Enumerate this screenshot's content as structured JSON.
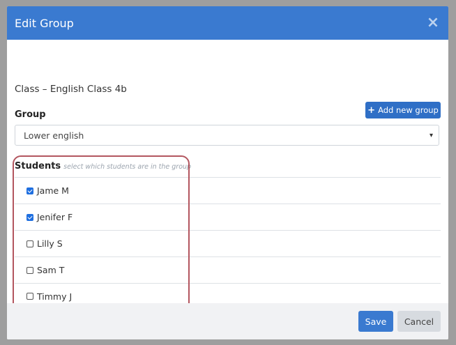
{
  "modal": {
    "title": "Edit Group",
    "close_icon": "×"
  },
  "class_line": "Class – English Class 4b",
  "group": {
    "label": "Group",
    "add_button_label": "Add new group",
    "add_icon": "+",
    "selected_value": "Lower english"
  },
  "students": {
    "label": "Students",
    "hint": "select which students are in the group",
    "items": [
      {
        "name": "Jame M",
        "checked": true
      },
      {
        "name": "Jenifer F",
        "checked": true
      },
      {
        "name": "Lilly S",
        "checked": false
      },
      {
        "name": "Sam T",
        "checked": false
      },
      {
        "name": "Timmy J",
        "checked": false
      }
    ]
  },
  "footer": {
    "save_label": "Save",
    "cancel_label": "Cancel"
  },
  "colors": {
    "header": "#3a7ad0",
    "primary_button": "#2f6fc6",
    "highlight_border": "#b3565f",
    "checkbox_checked": "#1f6fe0"
  }
}
